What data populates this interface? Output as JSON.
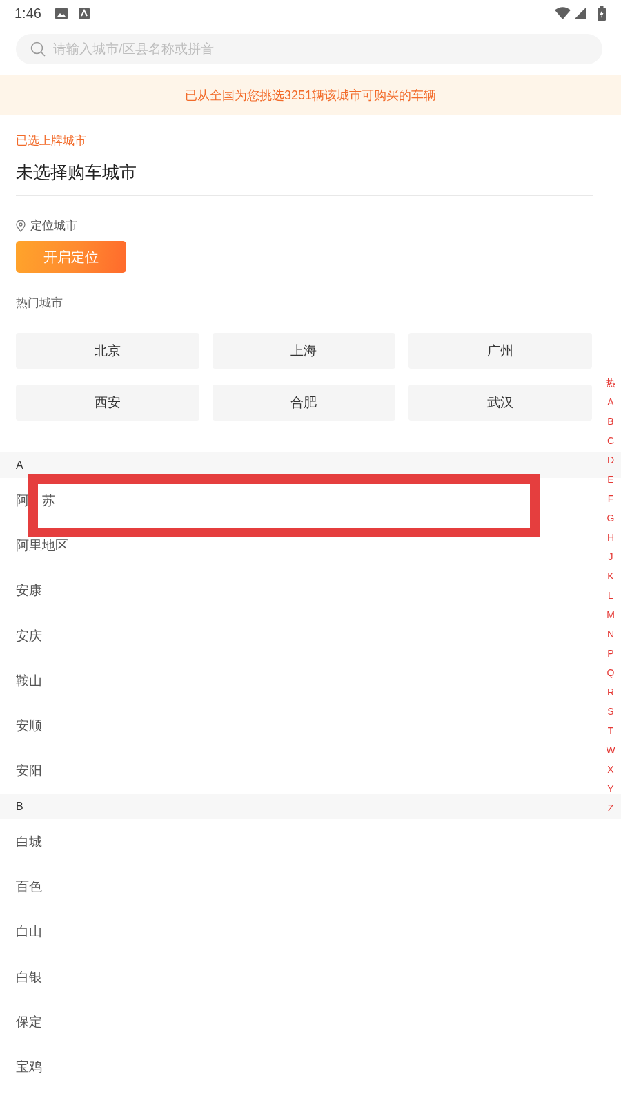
{
  "status_bar": {
    "time": "1:46"
  },
  "search": {
    "placeholder": "请输入城市/区县名称或拼音"
  },
  "banner": {
    "text": "已从全国为您挑选3251辆该城市可购买的车辆"
  },
  "selected_city": {
    "label": "已选上牌城市",
    "value": "未选择购车城市"
  },
  "location": {
    "label": "定位城市",
    "button": "开启定位"
  },
  "hot_cities": {
    "title": "热门城市",
    "cities": [
      "北京",
      "上海",
      "广州",
      "西安",
      "合肥",
      "武汉"
    ]
  },
  "city_sections": [
    {
      "letter": "A",
      "cities": [
        {
          "name": [
            "阿",
            "苏"
          ],
          "highlighted": true
        },
        {
          "name": "阿里地区",
          "highlighted": false
        },
        {
          "name": "安康",
          "highlighted": false
        },
        {
          "name": "安庆",
          "highlighted": false
        },
        {
          "name": "鞍山",
          "highlighted": false
        },
        {
          "name": "安顺",
          "highlighted": false
        },
        {
          "name": "安阳",
          "highlighted": false
        }
      ]
    },
    {
      "letter": "B",
      "cities": [
        {
          "name": "白城",
          "highlighted": false
        },
        {
          "name": "百色",
          "highlighted": false
        },
        {
          "name": "白山",
          "highlighted": false
        },
        {
          "name": "白银",
          "highlighted": false
        },
        {
          "name": "保定",
          "highlighted": false
        },
        {
          "name": "宝鸡",
          "highlighted": false
        }
      ]
    }
  ],
  "index_bar": [
    "热",
    "A",
    "B",
    "C",
    "D",
    "E",
    "F",
    "G",
    "H",
    "J",
    "K",
    "L",
    "M",
    "N",
    "P",
    "Q",
    "R",
    "S",
    "T",
    "W",
    "X",
    "Y",
    "Z"
  ]
}
